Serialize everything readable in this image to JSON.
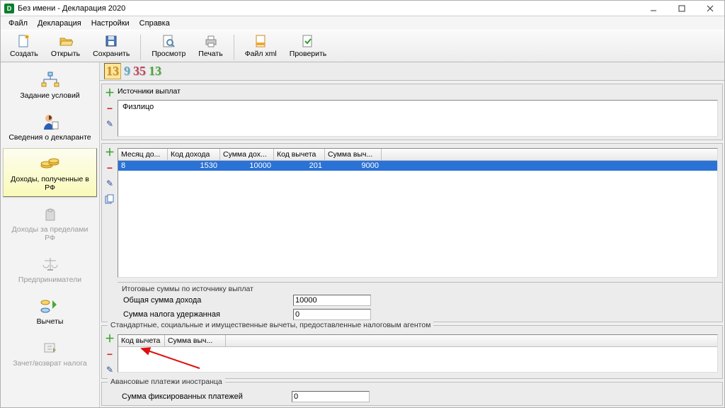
{
  "window": {
    "title": "Без имени - Декларация 2020"
  },
  "menu": {
    "file": "Файл",
    "decl": "Декларация",
    "settings": "Настройки",
    "help": "Справка"
  },
  "toolbar": {
    "create": "Создать",
    "open": "Открыть",
    "save": "Сохранить",
    "preview": "Просмотр",
    "print": "Печать",
    "xml": "Файл xml",
    "check": "Проверить"
  },
  "tabs": {
    "n1": "13",
    "n2": "9",
    "n3": "35",
    "n4": "13"
  },
  "sidebar": {
    "cond": "Задание условий",
    "declarant": "Сведения о декларанте",
    "income_rf": "Доходы, полученные в РФ",
    "income_abroad": "Доходы за пределами РФ",
    "entrepreneurs": "Предприниматели",
    "deductions": "Вычеты",
    "offset": "Зачет/возврат налога"
  },
  "sources": {
    "group_label": "Источники выплат",
    "items": [
      "Физлицо"
    ]
  },
  "payments": {
    "headers": [
      "Месяц до...",
      "Код дохода",
      "Сумма дох...",
      "Код вычета",
      "Сумма выч..."
    ],
    "rows": [
      {
        "month": "8",
        "inc_code": "1530",
        "inc_sum": "10000",
        "ded_code": "201",
        "ded_sum": "9000"
      }
    ]
  },
  "totals": {
    "group_label": "Итоговые суммы по источнику выплат",
    "total_income_label": "Общая сумма дохода",
    "total_income": "10000",
    "tax_withheld_label": "Сумма налога удержанная",
    "tax_withheld": "0"
  },
  "deductions": {
    "group_label": "Стандартные, социальные и имущественные вычеты, предоставленные налоговым агентом",
    "headers": [
      "Код вычета",
      "Сумма выч..."
    ]
  },
  "advance": {
    "group_label": "Авансовые платежи иностранца",
    "label": "Сумма фиксированных платежей",
    "value": "0"
  }
}
